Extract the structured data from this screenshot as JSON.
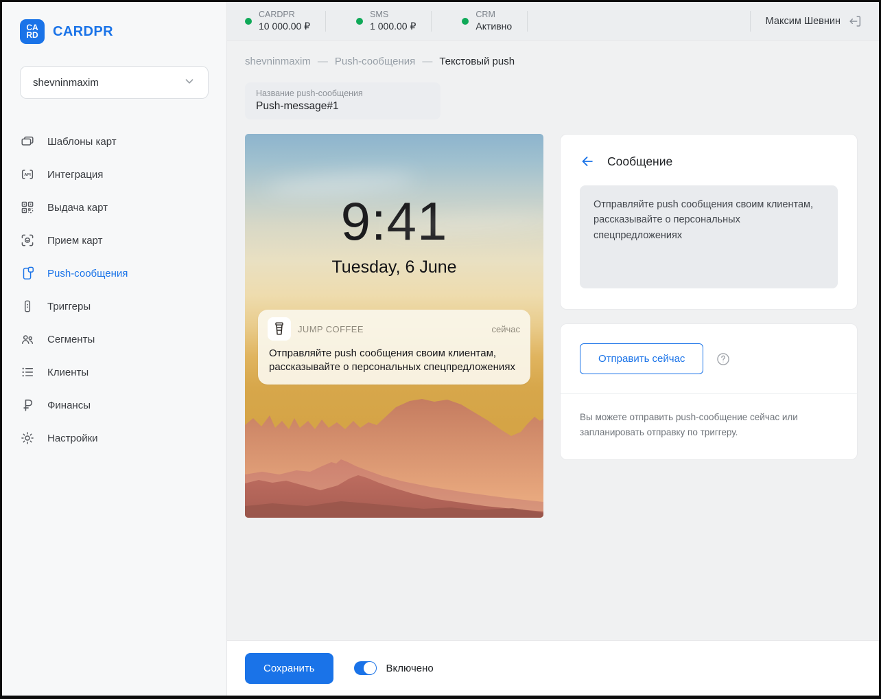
{
  "colors": {
    "accent": "#1a73e8",
    "status_green": "#0fa958"
  },
  "sidebar": {
    "logo": {
      "mark_line1": "CA",
      "mark_line2": "RD",
      "text": "CARDPR"
    },
    "account_selector": {
      "value": "shevninmaxim"
    },
    "nav": [
      {
        "label": "Шаблоны карт"
      },
      {
        "label": "Интеграция"
      },
      {
        "label": "Выдача карт"
      },
      {
        "label": "Прием карт"
      },
      {
        "label": "Push-сообщения"
      },
      {
        "label": "Триггеры"
      },
      {
        "label": "Сегменты"
      },
      {
        "label": "Клиенты"
      },
      {
        "label": "Финансы"
      },
      {
        "label": "Настройки"
      }
    ]
  },
  "topbar": {
    "statuses": [
      {
        "label": "CARDPR",
        "value": "10 000.00 ₽"
      },
      {
        "label": "SMS",
        "value": "1 000.00 ₽"
      },
      {
        "label": "CRM",
        "value": "Активно"
      }
    ],
    "user_name": "Максим Шевнин"
  },
  "breadcrumb": {
    "items": [
      "shevninmaxim",
      "Push-сообщения",
      "Текстовый push"
    ],
    "separator": "—"
  },
  "name_field": {
    "label": "Название push-сообщения",
    "value": "Push-message#1"
  },
  "phone_preview": {
    "time": "9:41",
    "date": "Tuesday, 6 June",
    "notification": {
      "app": "JUMP COFFEE",
      "when": "сейчас",
      "text": "Отправляйте push сообщения своим клиентам, рассказывайте о персональных спецпредложениях"
    }
  },
  "message_panel": {
    "title": "Сообщение",
    "text": "Отправляйте push сообщения своим клиентам, рассказывайте о персональных спецпредложениях"
  },
  "send_panel": {
    "button": "Отправить сейчас",
    "hint": "Вы можете отправить push-сообщение сейчас или запланировать отправку по триггеру."
  },
  "footer": {
    "save": "Сохранить",
    "toggle_label": "Включено",
    "toggle_on": true
  }
}
